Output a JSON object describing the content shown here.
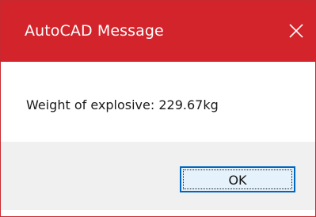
{
  "window": {
    "title": "AutoCAD Message",
    "close_icon": "close-icon",
    "accent_color": "#d3232b"
  },
  "message": {
    "text": "Weight of explosive: 229.67kg"
  },
  "buttons": {
    "ok_label": "OK"
  }
}
